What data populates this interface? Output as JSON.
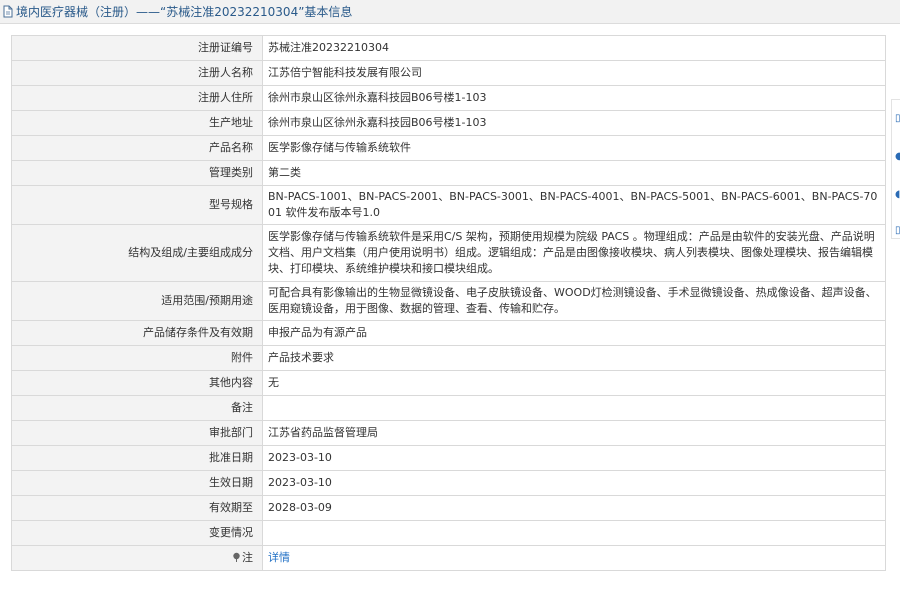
{
  "header": {
    "title": "境内医疗器械（注册）——“苏械注准20232210304”基本信息",
    "icon": "document-icon"
  },
  "rows": [
    {
      "key": "注册证编号",
      "value": "苏械注准20232210304",
      "h": 1
    },
    {
      "key": "注册人名称",
      "value": "江苏倍宁智能科技发展有限公司",
      "h": 1
    },
    {
      "key": "注册人住所",
      "value": "徐州市泉山区徐州永嘉科技园B06号楼1-103",
      "h": 1
    },
    {
      "key": "生产地址",
      "value": "徐州市泉山区徐州永嘉科技园B06号楼1-103",
      "h": 1
    },
    {
      "key": "产品名称",
      "value": "医学影像存储与传输系统软件",
      "h": 1
    },
    {
      "key": "管理类别",
      "value": "第二类",
      "h": 1
    },
    {
      "key": "型号规格",
      "value": "BN-PACS-1001、BN-PACS-2001、BN-PACS-3001、BN-PACS-4001、BN-PACS-5001、BN-PACS-6001、BN-PACS-7001 软件发布版本号1.0",
      "h": 2
    },
    {
      "key": "结构及组成/主要组成成分",
      "value": "医学影像存储与传输系统软件是采用C/S 架构，预期使用规模为院级 PACS 。物理组成：产品是由软件的安装光盘、产品说明文档、用户文档集（用户使用说明书）组成。逻辑组成：产品是由图像接收模块、病人列表模块、图像处理模块、报告编辑模块、打印模块、系统维护模块和接口模块组成。",
      "h": 3
    },
    {
      "key": "适用范围/预期用途",
      "value": "可配合具有影像输出的生物显微镜设备、电子皮肤镜设备、WOOD灯检测镜设备、手术显微镜设备、热成像设备、超声设备、医用窥镜设备，用于图像、数据的管理、查看、传输和贮存。",
      "h": 2
    },
    {
      "key": "产品储存条件及有效期",
      "value": "申报产品为有源产品",
      "h": 1
    },
    {
      "key": "附件",
      "value": "产品技术要求",
      "h": 1
    },
    {
      "key": "其他内容",
      "value": "无",
      "h": 1
    },
    {
      "key": "备注",
      "value": "",
      "h": 1
    },
    {
      "key": "审批部门",
      "value": "江苏省药品监督管理局",
      "h": 1
    },
    {
      "key": "批准日期",
      "value": "2023-03-10",
      "h": 1
    },
    {
      "key": "生效日期",
      "value": "2023-03-10",
      "h": 1
    },
    {
      "key": "有效期至",
      "value": "2028-03-09",
      "h": 1
    },
    {
      "key": "变更情况",
      "value": "",
      "h": 1
    }
  ],
  "note_row": {
    "key": "注",
    "link": "详情",
    "icon": "pin-icon"
  },
  "colors": {
    "header_bg": "#f2f2f2",
    "header_text": "#2a5a8a",
    "key_bg": "#f3f3f3",
    "border": "#d9d9d9",
    "link": "#1f6fc5"
  }
}
